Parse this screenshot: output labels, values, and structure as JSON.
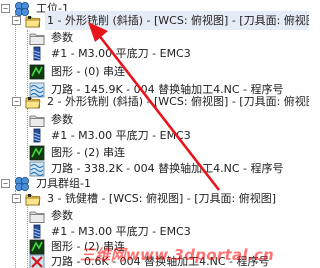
{
  "tree": {
    "root": {
      "label": "工位-1",
      "expander": "−"
    },
    "ops": [
      {
        "label": "1 - 外形铣削 (斜插) - [WCS: 俯视图] - [刀具面: 俯视图",
        "expander": "−",
        "params": "参数",
        "tool": "#1 - M3.00 平底刀 - EMC3",
        "geometry": "图形 - (0) 串连",
        "toolpath": "刀路 - 145.9K - 004 替换轴加工4.NC - 程序号"
      },
      {
        "label": "2 - 外形铣削 (斜插) - [WCS: 俯视图] - [刀具面: 俯视图",
        "expander": "−",
        "params": "参数",
        "tool": "#1 - M3.00 平底刀 - EMC3",
        "geometry": "图形 - (2) 串连",
        "toolpath": "刀路 - 338.2K - 004 替换轴加工4.NC - 程序号"
      }
    ],
    "group": {
      "label": "刀具群组-1",
      "expander": "−"
    },
    "group_ops": [
      {
        "label": "3 - 铣健槽 - [WCS: 俯视图] - [刀具面: 俯视图]",
        "expander": "−",
        "params": "参数",
        "tool": "#1 - M3.00 平底刀 - EMC3",
        "geometry": "图形 - (2) 串连",
        "toolpath": "刀路 - 0.6K - 004 替换轴加工4.NC - 程序号"
      }
    ]
  },
  "watermark": "三维网www.3dportal.cn",
  "colors": {
    "arrow": "#e8141b",
    "watermark": "#ff0000",
    "selection": "#e6ecf6"
  }
}
